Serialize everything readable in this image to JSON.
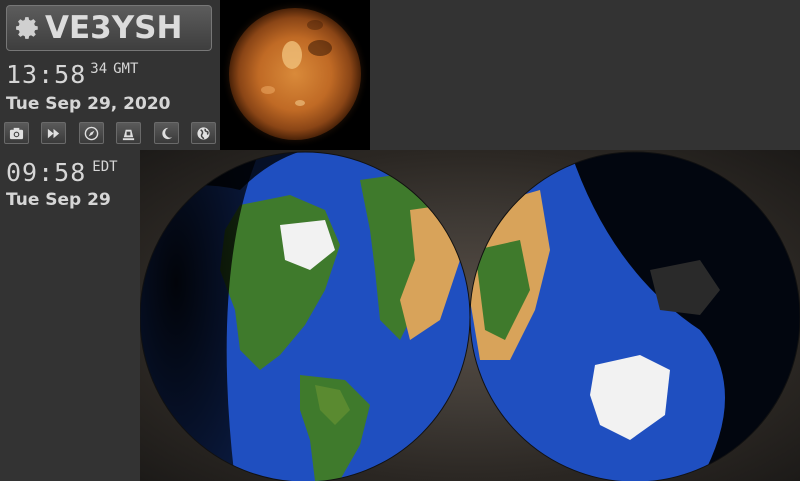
{
  "callsign": "VE3YSH",
  "utc_clock": {
    "hours_minutes": "13:58",
    "seconds": "34",
    "timezone": "GMT",
    "date": "Tue Sep 29, 2020"
  },
  "local_clock": {
    "hours_minutes": "09:58",
    "timezone": "EDT",
    "date": "Tue Sep 29"
  },
  "toolbar": {
    "buttons": [
      {
        "icon": "camera-icon"
      },
      {
        "icon": "fast-forward-icon"
      },
      {
        "icon": "compass-icon"
      },
      {
        "icon": "satellite-dish-icon"
      },
      {
        "icon": "moon-icon"
      },
      {
        "icon": "globe-icon"
      }
    ]
  },
  "colors": {
    "background": "#333333",
    "text": "#d6d6d6",
    "ocean": "#1f4fc0",
    "sun": "#c8772a"
  }
}
